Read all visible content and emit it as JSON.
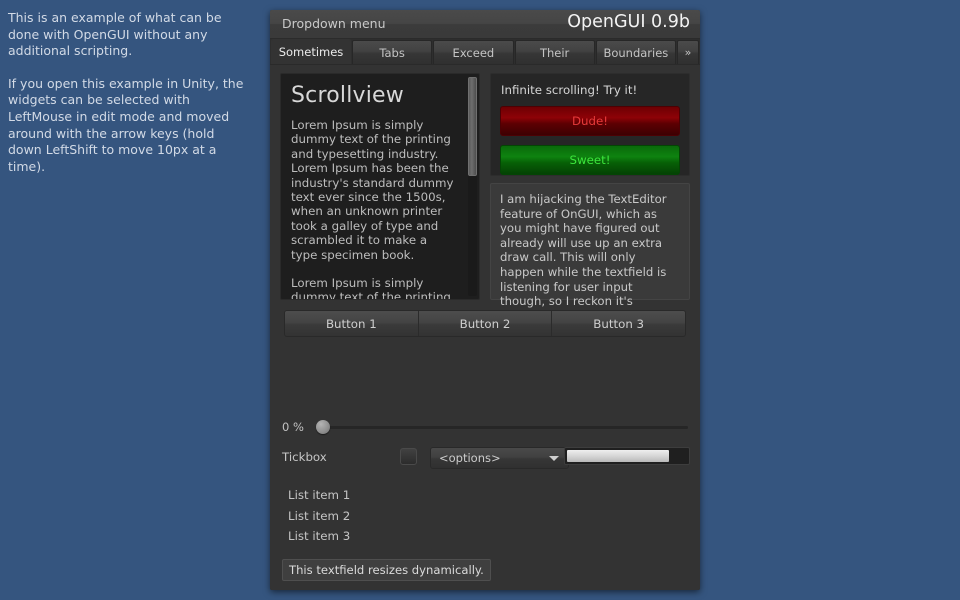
{
  "description": {
    "paragraph1": "This is an example of what can be done with OpenGUI without any additional scripting.",
    "paragraph2": "If you open this example in Unity, the widgets can be selected with LeftMouse in edit mode and moved around with the arrow keys (hold down LeftShift to move 10px at a time)."
  },
  "window": {
    "menu_label": "Dropdown menu",
    "app_title": "OpenGUI 0.9b",
    "tabs": [
      {
        "label": "Sometimes",
        "active": true
      },
      {
        "label": "Tabs",
        "active": false
      },
      {
        "label": "Exceed",
        "active": false
      },
      {
        "label": "Their",
        "active": false
      },
      {
        "label": "Boundaries",
        "active": false
      },
      {
        "label": "»",
        "active": false
      }
    ]
  },
  "scrollview": {
    "heading": "Scrollview",
    "paragraph1": "Lorem Ipsum is simply dummy text of the printing and typesetting industry. Lorem Ipsum has been the industry's standard dummy text ever since the 1500s, when an unknown printer took a galley of type and scrambled it to make a type specimen book.",
    "paragraph2": "Lorem Ipsum is simply dummy text of the printing and typesetting industry. Lorem",
    "scroll_thumb_percent": 45
  },
  "infinite_panel": {
    "heading": "Infinite scrolling! Try it!",
    "button_red": "Dude!",
    "button_green": "Sweet!",
    "color_red": "#8e0207",
    "color_green": "#0e8310"
  },
  "text_editor": {
    "content": "I am hijacking the TextEditor feature of OnGUI, which as you might have figured out already will use up an extra draw call. This will only happen while the textfield is listening for user input though, so I reckon it's affordable."
  },
  "button_bar": {
    "buttons": [
      "Button 1",
      "Button 2",
      "Button 3"
    ]
  },
  "slider": {
    "value_label": "0 %",
    "value": 0
  },
  "controls": {
    "tickbox_label": "Tickbox",
    "tickbox_checked": false,
    "dropdown_value": "<options>",
    "progress_percent": 85
  },
  "list": {
    "items": [
      "List item 1",
      "List item 2",
      "List item 3"
    ]
  },
  "dynamic_textfield": {
    "value": "This textfield resizes dynamically."
  },
  "theme": {
    "desktop_bg": "#35557f",
    "window_bg": "#333333",
    "panel_bg": "#1e1e1e"
  }
}
